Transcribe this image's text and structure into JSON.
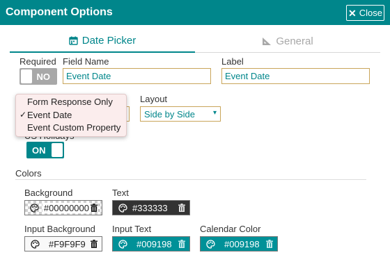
{
  "window": {
    "title": "Component Options",
    "close_label": "Close"
  },
  "tabs": [
    {
      "label": "Date Picker",
      "icon": "calendar-icon"
    },
    {
      "label": "General",
      "icon": "ruler-triangle-icon"
    }
  ],
  "fields": {
    "required_label": "Required",
    "required_toggle_text": "NO",
    "field_name_label": "Field Name",
    "field_name_value": "Event Date",
    "label_label": "Label",
    "label_value": "Event Date",
    "layout_label": "Layout",
    "layout_value": "Side by Side",
    "holidays_label_partial": "US Holidays",
    "holidays_toggle_text": "ON"
  },
  "source_dropdown": {
    "options": [
      "Form Response Only",
      "Event Date",
      "Event Custom Property"
    ],
    "selected": "Event Date",
    "check_mark": "✓"
  },
  "colors": {
    "section_title": "Colors",
    "items": [
      {
        "label": "Background",
        "value": "#00000000",
        "style": "checker"
      },
      {
        "label": "Text",
        "value": "#333333",
        "swatch": "#333333"
      },
      {
        "label": "Input Background",
        "value": "#F9F9F9",
        "swatch": "#F9F9F9"
      },
      {
        "label": "Input Text",
        "value": "#009198",
        "swatch": "#009198"
      },
      {
        "label": "Calendar Color",
        "value": "#009198",
        "swatch": "#009198"
      }
    ]
  },
  "theme": {
    "accent": "#00868b",
    "input_border": "#c9a55a",
    "toggle_off": "#a8a8a8"
  }
}
